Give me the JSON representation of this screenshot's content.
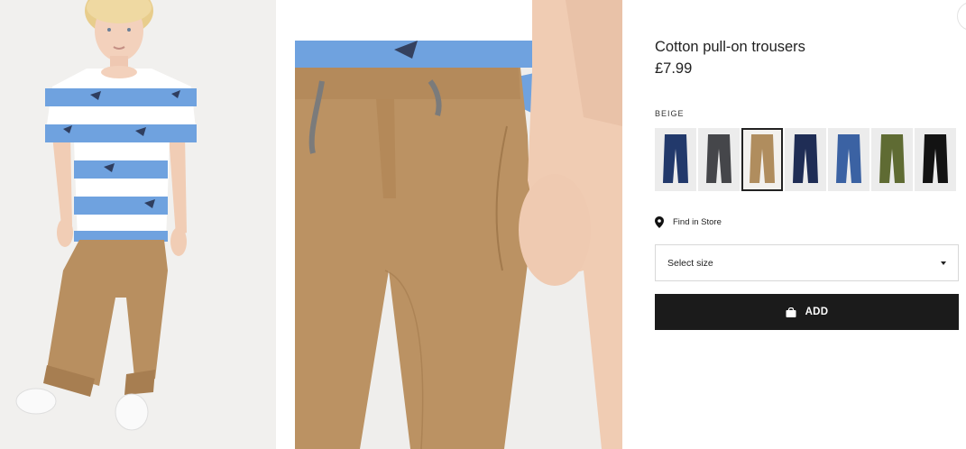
{
  "product": {
    "title": "Cotton pull-on trousers",
    "price": "£7.99",
    "selected_color_label": "BEIGE"
  },
  "swatches": [
    {
      "color": "#22396b",
      "selected": false
    },
    {
      "color": "#45464a",
      "selected": false
    },
    {
      "color": "#b08d5e",
      "selected": true
    },
    {
      "color": "#1f2d55",
      "selected": false
    },
    {
      "color": "#3b62a3",
      "selected": false
    },
    {
      "color": "#5f6b33",
      "selected": false
    },
    {
      "color": "#131313",
      "selected": false
    }
  ],
  "find_in_store": {
    "label": "Find in Store",
    "icon": "location-pin-icon"
  },
  "size_select": {
    "label": "Select size"
  },
  "add_button": {
    "label": "ADD",
    "icon": "shopping-bag-icon"
  },
  "colors": {
    "button_bg": "#1b1b1b",
    "border": "#d8d8d8"
  }
}
